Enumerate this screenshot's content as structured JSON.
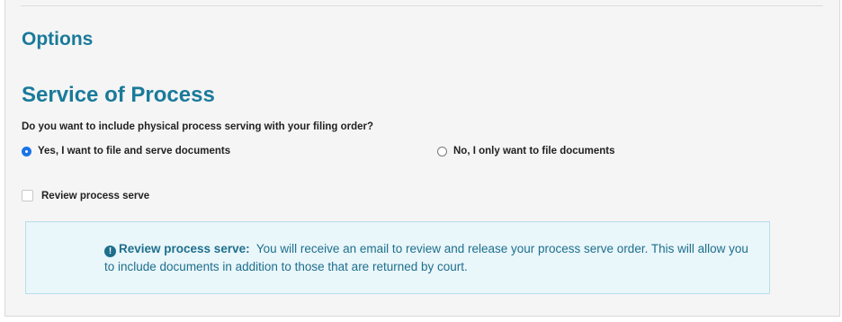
{
  "options": {
    "heading": "Options"
  },
  "service_of_process": {
    "heading": "Service of Process",
    "question": "Do you want to include physical process serving with your filing order?",
    "radio_options": [
      {
        "label": "Yes, I want to file and serve documents",
        "selected": true
      },
      {
        "label": "No, I only want to file documents",
        "selected": false
      }
    ],
    "review_checkbox": {
      "label": "Review process serve",
      "checked": false
    },
    "info": {
      "icon": "exclamation-circle-icon",
      "title": "Review process serve:",
      "message": "You will receive an email to review and release your process serve order. This will allow you to include documents in addition to those that are returned by court."
    }
  },
  "colors": {
    "heading": "#1a7a9a",
    "panel_background": "#f5f5f5",
    "info_background": "#e9f6fa",
    "info_text": "#1e6f8c",
    "radio_selected": "#1a73e8"
  }
}
